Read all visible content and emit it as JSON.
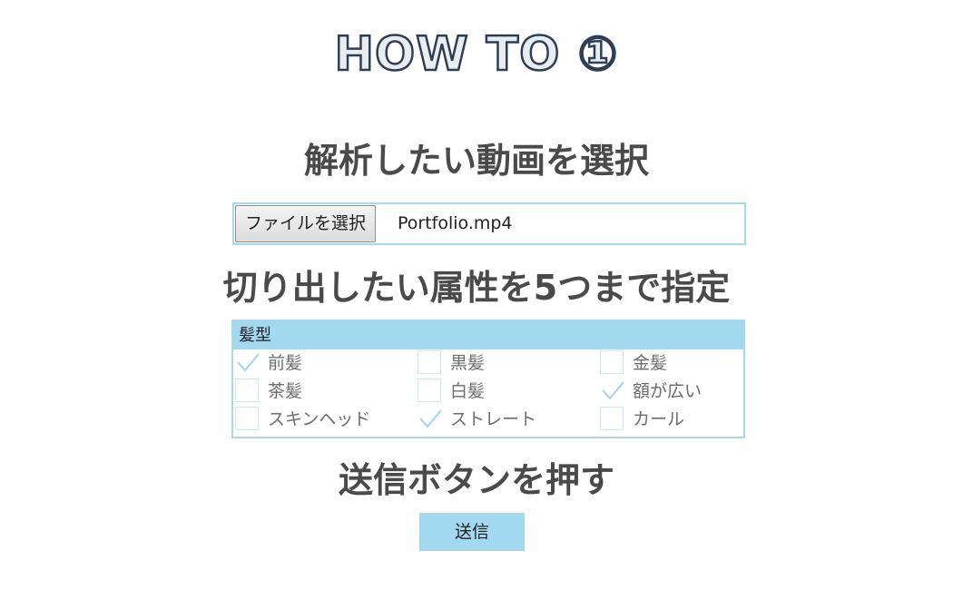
{
  "title": "HOW TO ①",
  "steps": {
    "select_video": "解析したい動画を選択",
    "select_attributes": "切り出したい属性を5つまで指定",
    "press_submit": "送信ボタンを押す"
  },
  "file_input": {
    "button_label": "ファイルを選択",
    "file_name": "Portfolio.mp4"
  },
  "attributes": {
    "group_label": "髪型",
    "options": [
      {
        "label": "前髪",
        "checked": true
      },
      {
        "label": "黒髪",
        "checked": false
      },
      {
        "label": "金髪",
        "checked": false
      },
      {
        "label": "茶髪",
        "checked": false
      },
      {
        "label": "白髪",
        "checked": false
      },
      {
        "label": "額が広い",
        "checked": true
      },
      {
        "label": "スキンヘッド",
        "checked": false
      },
      {
        "label": "ストレート",
        "checked": true
      },
      {
        "label": "カール",
        "checked": false
      }
    ]
  },
  "submit": {
    "label": "送信"
  },
  "colors": {
    "accent": "#a3d8f1",
    "title_stroke": "#2e3f55",
    "heading": "#4a4a4a",
    "checkmark": "#9fd3ec"
  }
}
